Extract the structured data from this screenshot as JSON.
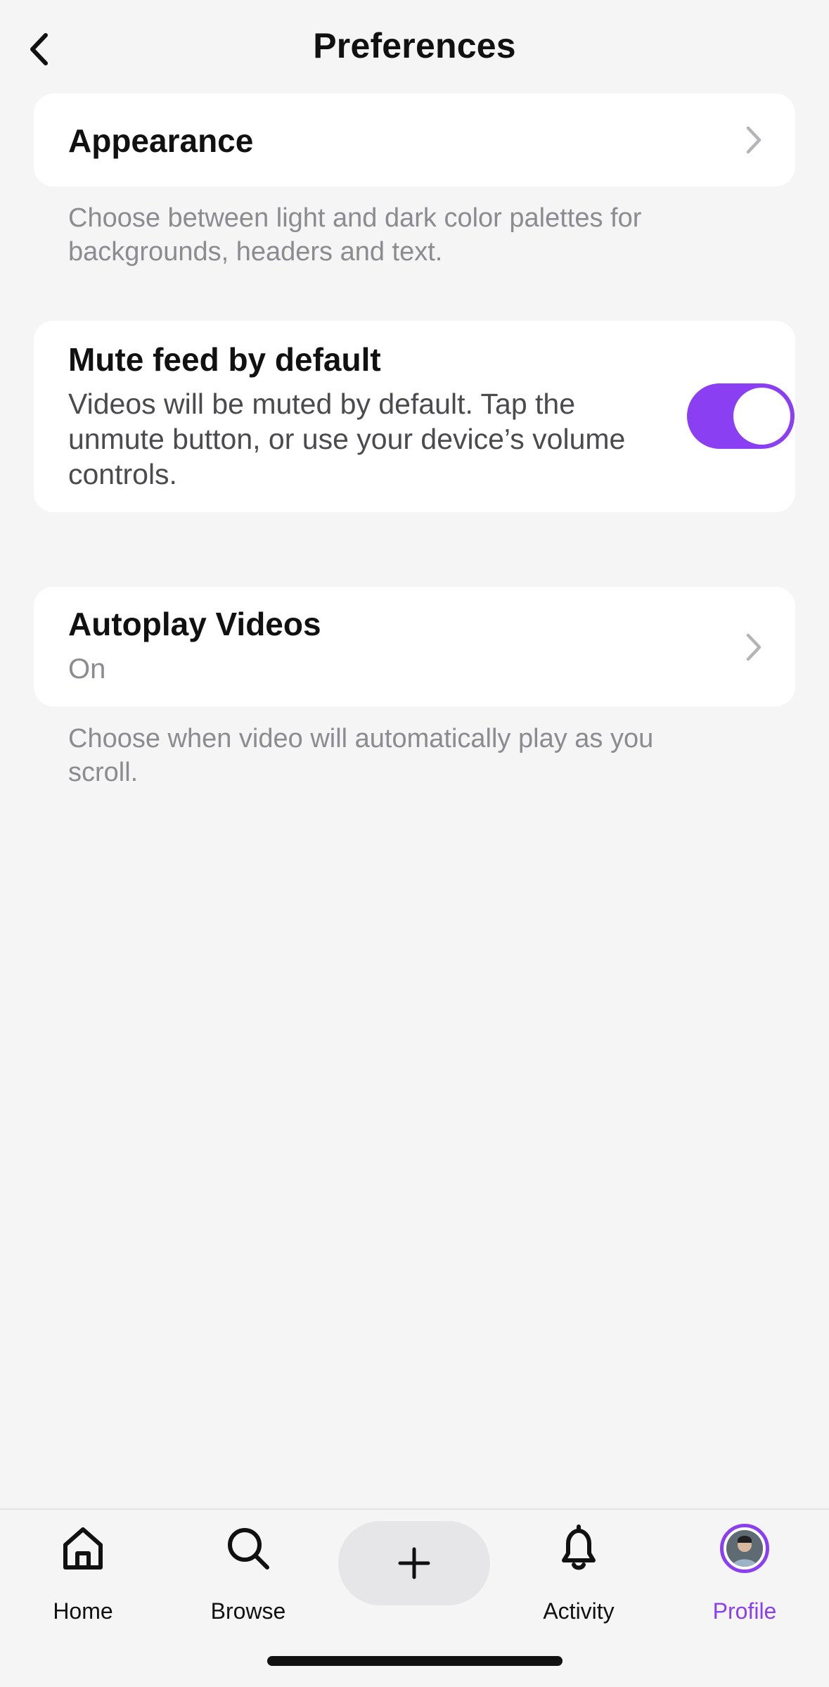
{
  "header": {
    "title": "Preferences",
    "back_icon": "chevron-left-icon"
  },
  "appearance": {
    "title": "Appearance",
    "helper": "Choose between light and dark color palettes for backgrounds, headers and text."
  },
  "mute": {
    "title": "Mute feed by default",
    "description": "Videos will be muted by default. Tap the unmute button, or use your device’s volume controls.",
    "enabled": true
  },
  "autoplay": {
    "title": "Autoplay Videos",
    "value": "On",
    "helper": "Choose when video will automatically play as you scroll."
  },
  "tabbar": {
    "home": "Home",
    "browse": "Browse",
    "activity": "Activity",
    "profile": "Profile"
  },
  "colors": {
    "accent": "#8b3ff3",
    "background": "#f5f5f6",
    "card": "#ffffff",
    "muted_text": "#8b8b90"
  }
}
